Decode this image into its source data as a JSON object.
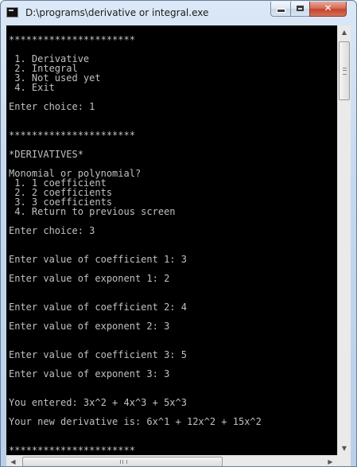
{
  "window": {
    "title": "D:\\programs\\derivative or integral.exe",
    "buttons": {
      "minimize": "",
      "maximize": "",
      "close": "✕"
    }
  },
  "console": {
    "lines": [
      "**********************",
      "",
      " 1. Derivative",
      " 2. Integral",
      " 3. Not used yet",
      " 4. Exit",
      "",
      "Enter choice: 1",
      "",
      "",
      "**********************",
      "",
      "*DERIVATIVES*",
      "",
      "Monomial or polynomial?",
      " 1. 1 coefficient",
      " 2. 2 coefficients",
      " 3. 3 coefficients",
      " 4. Return to previous screen",
      "",
      "Enter choice: 3",
      "",
      "",
      "Enter value of coefficient 1: 3",
      "",
      "Enter value of exponent 1: 2",
      "",
      "",
      "Enter value of coefficient 2: 4",
      "",
      "Enter value of exponent 2: 3",
      "",
      "",
      "Enter value of coefficient 3: 5",
      "",
      "Enter value of exponent 3: 3",
      "",
      "",
      "You entered: 3x^2 + 4x^3 + 5x^3",
      "",
      "Your new derivative is: 6x^1 + 12x^2 + 15x^2",
      "",
      "",
      "**********************"
    ],
    "colors": {
      "background": "#000000",
      "foreground": "#c0c0c0"
    }
  },
  "scrollbars": {
    "vertical": {
      "up_icon": "▲",
      "down_icon": "▼"
    },
    "horizontal": {
      "left_icon": "◀",
      "right_icon": "▶"
    }
  }
}
